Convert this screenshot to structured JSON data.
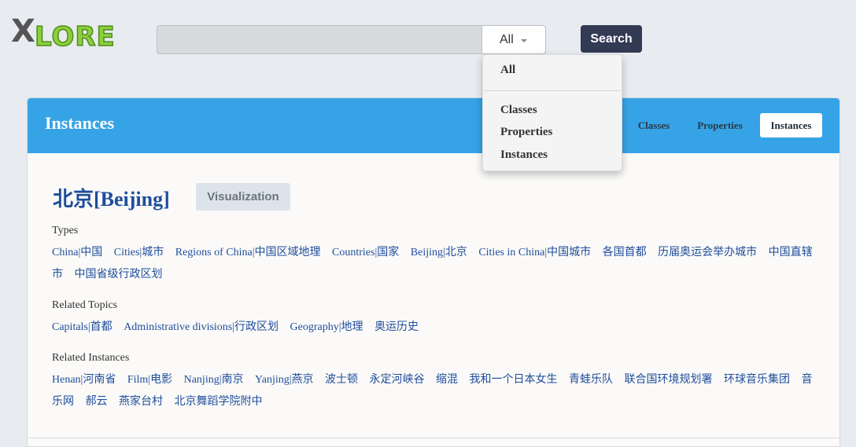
{
  "logo": {
    "x_mark": "X",
    "text": "LORE"
  },
  "search": {
    "query": "",
    "scope_selected": "All",
    "button_label": "Search"
  },
  "dropdown": {
    "items": [
      "All",
      "Classes",
      "Properties",
      "Instances"
    ]
  },
  "panel": {
    "title": "Instances",
    "tabs": [
      "Classes",
      "Properties",
      "Instances"
    ],
    "active_tab": "Instances"
  },
  "entity": {
    "title": "北京[Beijing]",
    "visualization_label": "Visualization",
    "types_label": "Types",
    "types": [
      "China|中国",
      "Cities|城市",
      "Regions of China|中国区域地理",
      "Countries|国家",
      "Beijing|北京",
      "Cities in China|中国城市",
      "各国首都",
      "历届奥运会举办城市",
      "中国直辖市",
      "中国省级行政区划"
    ],
    "topics_label": "Related Topics",
    "topics": [
      "Capitals|首都",
      "Administrative divisions|行政区划",
      "Geography|地理",
      "奥运历史"
    ],
    "instances_label": "Related Instances",
    "instances": [
      "Henan|河南省",
      "Film|电影",
      "Nanjing|南京",
      "Yanjing|燕京",
      "波士顿",
      "永定河峡谷",
      "缩混",
      "我和一个日本女生",
      "青蛙乐队",
      "联合国环境规划署",
      "环球音乐集团",
      "音乐网",
      "郝云",
      "燕家台村",
      "北京舞蹈学院附中"
    ]
  },
  "colors": {
    "header_blue": "#36a3e6",
    "link_blue": "#1f4d9c",
    "search_button": "#333a54"
  }
}
